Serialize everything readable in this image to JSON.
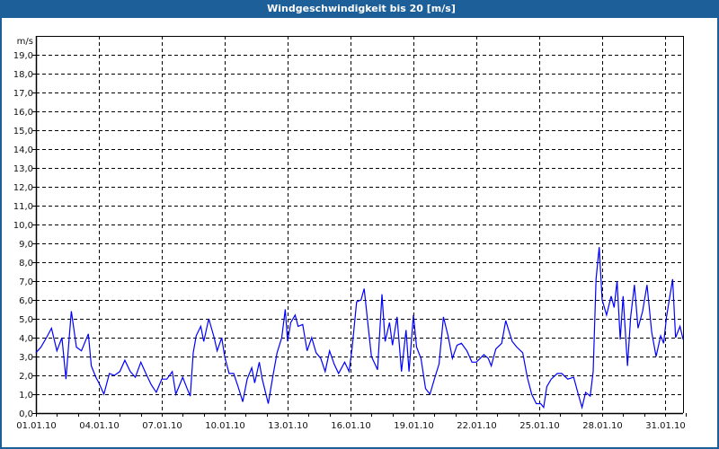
{
  "window": {
    "title": "Windgeschwindigkeit bis 20 [m/s]"
  },
  "colors": {
    "titlebar": "#1d5f98",
    "line": "#0000ff",
    "grid": "#000000"
  },
  "chart_data": {
    "type": "line",
    "title": "Windgeschwindigkeit bis 20 [m/s]",
    "ylabel": "m/s",
    "xlabel": "",
    "ylim": [
      0,
      20
    ],
    "xlim_days": [
      0,
      31
    ],
    "grid": true,
    "y_ticks": [
      "0,0",
      "1,0",
      "2,0",
      "3,0",
      "4,0",
      "5,0",
      "6,0",
      "7,0",
      "8,0",
      "9,0",
      "10,0",
      "11,0",
      "12,0",
      "13,0",
      "14,0",
      "15,0",
      "16,0",
      "17,0",
      "18,0",
      "19,0"
    ],
    "x_ticks": [
      {
        "day": 0,
        "label": "01.01.10"
      },
      {
        "day": 3,
        "label": "04.01.10"
      },
      {
        "day": 6,
        "label": "07.01.10"
      },
      {
        "day": 9,
        "label": "10.01.10"
      },
      {
        "day": 12,
        "label": "13.01.10"
      },
      {
        "day": 15,
        "label": "16.01.10"
      },
      {
        "day": 18,
        "label": "19.01.10"
      },
      {
        "day": 21,
        "label": "22.01.10"
      },
      {
        "day": 24,
        "label": "25.01.10"
      },
      {
        "day": 27,
        "label": "28.01.10"
      },
      {
        "day": 30,
        "label": "31.01.10"
      }
    ],
    "series": [
      {
        "name": "Windgeschwindigkeit",
        "points_day_value": [
          [
            0.0,
            3.2
          ],
          [
            0.24,
            3.5
          ],
          [
            0.5,
            4.0
          ],
          [
            0.74,
            4.5
          ],
          [
            1.0,
            3.3
          ],
          [
            1.24,
            4.0
          ],
          [
            1.43,
            1.8
          ],
          [
            1.67,
            5.2
          ],
          [
            1.69,
            5.4
          ],
          [
            1.93,
            3.5
          ],
          [
            2.17,
            3.3
          ],
          [
            2.5,
            4.2
          ],
          [
            2.64,
            2.5
          ],
          [
            2.86,
            1.9
          ],
          [
            3.0,
            1.6
          ],
          [
            3.24,
            1.0
          ],
          [
            3.5,
            2.1
          ],
          [
            3.74,
            2.0
          ],
          [
            4.0,
            2.2
          ],
          [
            4.24,
            2.8
          ],
          [
            4.5,
            2.2
          ],
          [
            4.74,
            1.9
          ],
          [
            5.0,
            2.7
          ],
          [
            5.24,
            2.1
          ],
          [
            5.5,
            1.5
          ],
          [
            5.74,
            1.1
          ],
          [
            6.0,
            1.8
          ],
          [
            6.24,
            1.8
          ],
          [
            6.5,
            2.2
          ],
          [
            6.67,
            1.0
          ],
          [
            7.0,
            1.9
          ],
          [
            7.21,
            1.3
          ],
          [
            7.36,
            0.9
          ],
          [
            7.5,
            3.2
          ],
          [
            7.64,
            4.1
          ],
          [
            7.86,
            4.6
          ],
          [
            8.0,
            3.8
          ],
          [
            8.24,
            5.0
          ],
          [
            8.5,
            4.0
          ],
          [
            8.64,
            3.3
          ],
          [
            8.86,
            4.0
          ],
          [
            9.0,
            3.0
          ],
          [
            9.21,
            2.1
          ],
          [
            9.43,
            2.1
          ],
          [
            9.64,
            1.4
          ],
          [
            9.86,
            0.6
          ],
          [
            10.07,
            1.8
          ],
          [
            10.29,
            2.4
          ],
          [
            10.43,
            1.6
          ],
          [
            10.65,
            2.7
          ],
          [
            10.79,
            1.8
          ],
          [
            11.08,
            0.5
          ],
          [
            11.29,
            1.9
          ],
          [
            11.5,
            3.2
          ],
          [
            11.72,
            4.0
          ],
          [
            11.89,
            5.5
          ],
          [
            12.0,
            3.8
          ],
          [
            12.15,
            4.8
          ],
          [
            12.36,
            5.2
          ],
          [
            12.5,
            4.6
          ],
          [
            12.72,
            4.7
          ],
          [
            12.93,
            3.3
          ],
          [
            13.15,
            4.0
          ],
          [
            13.36,
            3.2
          ],
          [
            13.58,
            2.9
          ],
          [
            13.79,
            2.2
          ],
          [
            14.0,
            3.3
          ],
          [
            14.22,
            2.6
          ],
          [
            14.43,
            2.1
          ],
          [
            14.72,
            2.7
          ],
          [
            14.93,
            2.2
          ],
          [
            15.08,
            3.5
          ],
          [
            15.29,
            5.9
          ],
          [
            15.5,
            6.0
          ],
          [
            15.65,
            6.6
          ],
          [
            15.86,
            4.4
          ],
          [
            16.0,
            3.0
          ],
          [
            16.29,
            2.3
          ],
          [
            16.5,
            6.3
          ],
          [
            16.65,
            3.8
          ],
          [
            16.86,
            4.8
          ],
          [
            17.0,
            3.6
          ],
          [
            17.22,
            5.1
          ],
          [
            17.43,
            2.2
          ],
          [
            17.65,
            4.4
          ],
          [
            17.79,
            2.2
          ],
          [
            18.0,
            5.2
          ],
          [
            18.15,
            3.5
          ],
          [
            18.36,
            2.9
          ],
          [
            18.58,
            1.3
          ],
          [
            18.79,
            1.0
          ],
          [
            19.0,
            1.8
          ],
          [
            19.22,
            2.6
          ],
          [
            19.43,
            5.1
          ],
          [
            19.65,
            4.1
          ],
          [
            19.86,
            2.9
          ],
          [
            20.08,
            3.6
          ],
          [
            20.29,
            3.7
          ],
          [
            20.55,
            3.3
          ],
          [
            20.79,
            2.7
          ],
          [
            21.0,
            2.7
          ],
          [
            21.36,
            3.1
          ],
          [
            21.57,
            2.9
          ],
          [
            21.71,
            2.5
          ],
          [
            21.93,
            3.4
          ],
          [
            22.21,
            3.7
          ],
          [
            22.4,
            4.9
          ],
          [
            22.57,
            4.3
          ],
          [
            22.71,
            3.8
          ],
          [
            22.93,
            3.5
          ],
          [
            23.21,
            3.2
          ],
          [
            23.43,
            1.9
          ],
          [
            23.64,
            1.0
          ],
          [
            23.86,
            0.5
          ],
          [
            24.07,
            0.5
          ],
          [
            24.21,
            0.3
          ],
          [
            24.36,
            1.4
          ],
          [
            24.57,
            1.8
          ],
          [
            24.86,
            2.1
          ],
          [
            25.07,
            2.1
          ],
          [
            25.36,
            1.8
          ],
          [
            25.64,
            1.9
          ],
          [
            25.86,
            1.0
          ],
          [
            26.04,
            0.3
          ],
          [
            26.21,
            1.1
          ],
          [
            26.43,
            0.9
          ],
          [
            26.57,
            2.2
          ],
          [
            26.71,
            7.1
          ],
          [
            26.86,
            8.8
          ],
          [
            27.0,
            6.0
          ],
          [
            27.21,
            5.2
          ],
          [
            27.43,
            6.2
          ],
          [
            27.57,
            5.6
          ],
          [
            27.71,
            7.0
          ],
          [
            27.86,
            3.9
          ],
          [
            28.0,
            6.2
          ],
          [
            28.21,
            2.5
          ],
          [
            28.36,
            5.1
          ],
          [
            28.54,
            6.8
          ],
          [
            28.71,
            4.5
          ],
          [
            28.93,
            5.4
          ],
          [
            29.14,
            6.8
          ],
          [
            29.36,
            4.3
          ],
          [
            29.57,
            3.0
          ],
          [
            29.79,
            4.1
          ],
          [
            29.93,
            3.7
          ],
          [
            30.07,
            5.1
          ],
          [
            30.36,
            7.1
          ],
          [
            30.5,
            4.0
          ],
          [
            30.71,
            4.6
          ],
          [
            30.86,
            3.9
          ]
        ]
      }
    ]
  }
}
